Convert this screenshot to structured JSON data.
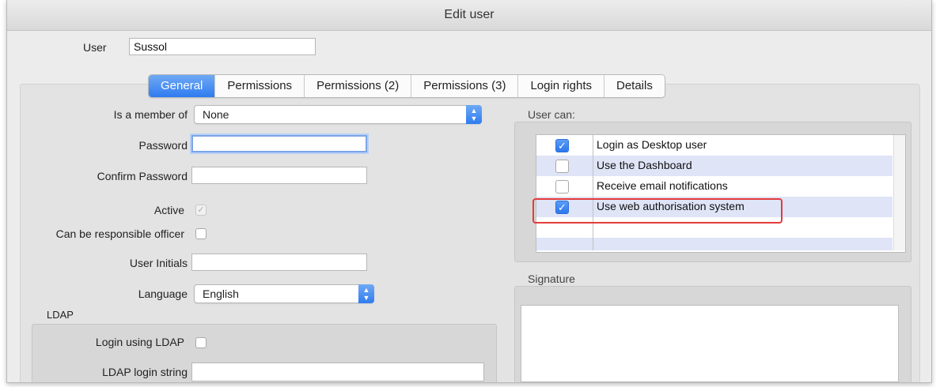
{
  "window": {
    "title": "Edit user"
  },
  "user": {
    "label": "User",
    "value": "Sussol"
  },
  "tabs": [
    "General",
    "Permissions",
    "Permissions (2)",
    "Permissions (3)",
    "Login rights",
    "Details"
  ],
  "form": {
    "member_label": "Is a member of",
    "member_value": "None",
    "password_label": "Password",
    "confirm_label": "Confirm Password",
    "active_label": "Active",
    "responsible_label": "Can be responsible officer",
    "initials_label": "User Initials",
    "language_label": "Language",
    "language_value": "English"
  },
  "ldap": {
    "title": "LDAP",
    "login_using_label": "Login using LDAP",
    "login_string_label": "LDAP login string"
  },
  "user_can": {
    "title": "User can:",
    "items": [
      {
        "label": "Login as Desktop user",
        "checked": true
      },
      {
        "label": "Use the Dashboard",
        "checked": false
      },
      {
        "label": "Receive email notifications",
        "checked": false
      },
      {
        "label": "Use web authorisation system",
        "checked": true
      }
    ]
  },
  "signature": {
    "title": "Signature"
  },
  "colors": {
    "accent": "#2f7cf0",
    "highlight": "#e43a3a",
    "row_alt": "#dfe4f7"
  }
}
